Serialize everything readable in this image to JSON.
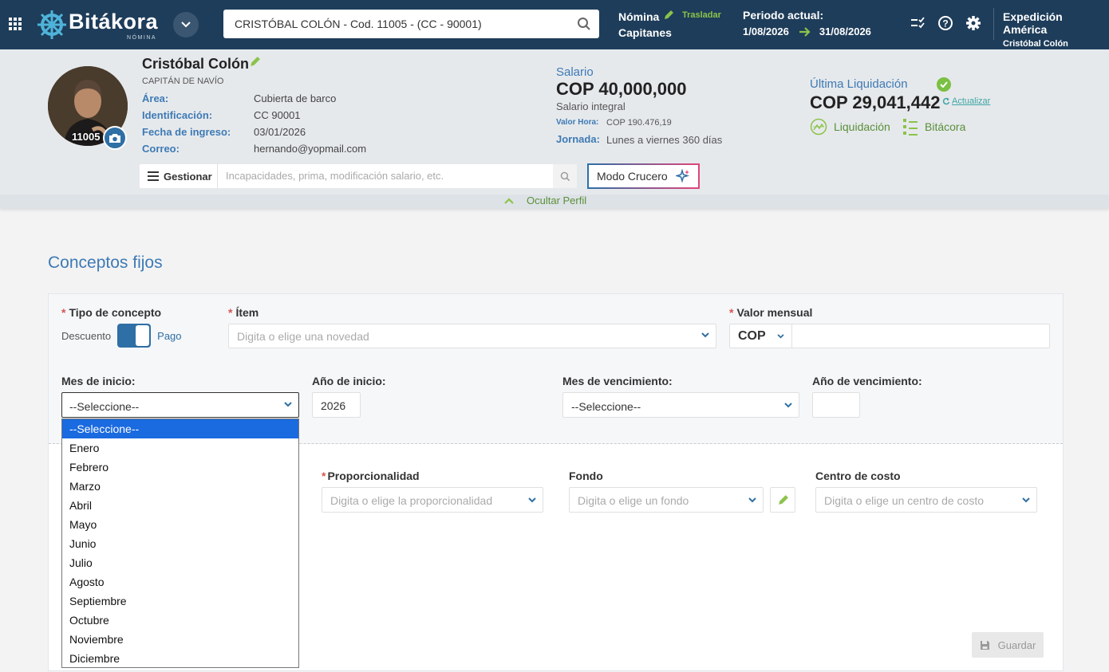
{
  "topbar": {
    "brand": "Bitákora",
    "brand_sub": "NÓMINA",
    "search_value": "CRISTÓBAL COLÓN - Cod. 11005 - (CC - 90001)",
    "nomina_label": "Nómina",
    "nomina_group": "Capitanes",
    "trasladar": "Trasladar",
    "periodo_label": "Periodo actual:",
    "periodo_start": "1/08/2026",
    "periodo_end": "31/08/2026",
    "company_name": "Expedición América",
    "company_user": "Cristóbal Colón"
  },
  "profile": {
    "code": "11005",
    "name": "Cristóbal Colón",
    "role": "CAPITÁN DE NAVÍO",
    "fields": [
      {
        "label": "Área:",
        "value": "Cubierta de barco"
      },
      {
        "label": "Identificación:",
        "value": "CC 90001"
      },
      {
        "label": "Fecha de ingreso:",
        "value": "03/01/2026"
      },
      {
        "label": "Correo:",
        "value": "hernando@yopmail.com"
      }
    ],
    "gestionar": "Gestionar",
    "gestionar_placeholder": "Incapacidades, prima, modificación salario, etc.",
    "modo_crucero": "Modo Crucero",
    "salario_label": "Salario",
    "salario_value": "COP 40,000,000",
    "salario_type": "Salario integral",
    "valor_hora_label": "Valor Hora:",
    "valor_hora_value": "COP 190.476,19",
    "jornada_label": "Jornada:",
    "jornada_value": "Lunes a viernes 360 días",
    "ultima_label": "Última Liquidación",
    "ultima_value": "COP 29,041,442",
    "actualizar": "Actualizar",
    "liquidacion": "Liquidación",
    "bitacora": "Bitácora",
    "ocultar": "Ocultar Perfil"
  },
  "form": {
    "title": "Conceptos fijos",
    "tipo_label": "Tipo de concepto",
    "descuento": "Descuento",
    "pago": "Pago",
    "item_label": "Ítem",
    "item_placeholder": "Digita o elige una novedad",
    "valor_label": "Valor mensual",
    "currency": "COP",
    "mes_inicio_label": "Mes de inicio:",
    "mes_inicio_value": "--Seleccione--",
    "anio_inicio_label": "Año de inicio:",
    "anio_inicio_value": "2026",
    "mes_venc_label": "Mes de vencimiento:",
    "mes_venc_value": "--Seleccione--",
    "anio_venc_label": "Año de vencimiento:",
    "prop_label": "Proporcionalidad",
    "prop_placeholder": "Digita o elige la proporcionalidad",
    "fondo_label": "Fondo",
    "fondo_placeholder": "Digita o elige un fondo",
    "centro_label": "Centro de costo",
    "centro_placeholder": "Digita o elige un centro de costo",
    "guardar": "Guardar"
  },
  "months": [
    "--Seleccione--",
    "Enero",
    "Febrero",
    "Marzo",
    "Abril",
    "Mayo",
    "Junio",
    "Julio",
    "Agosto",
    "Septiembre",
    "Octubre",
    "Noviembre",
    "Diciembre"
  ],
  "colors": {
    "topbar": "#1e3d5a",
    "accent": "#3d7ab5",
    "green": "#8bc34a",
    "selected": "#1a6ae0"
  }
}
